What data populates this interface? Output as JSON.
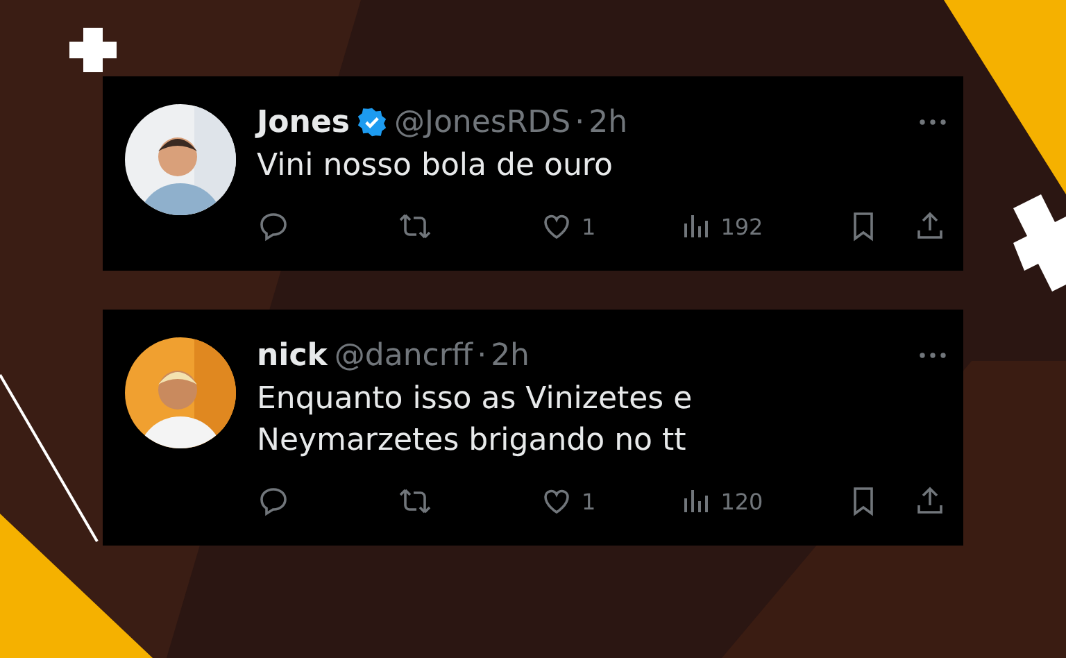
{
  "tweets": [
    {
      "name": "Jones",
      "verified": true,
      "handle": "@JonesRDS",
      "sep": "·",
      "time": "2h",
      "text": [
        "Vini nosso bola de ouro"
      ],
      "avatar": {
        "kind": "picture"
      },
      "likes": "1",
      "views": "192"
    },
    {
      "name": "nick",
      "verified": false,
      "handle": "@dancrff",
      "sep": "·",
      "time": "2h",
      "text": [
        "Enquanto isso as Vinizetes e",
        "Neymarzetes brigando no tt"
      ],
      "avatar": {
        "kind": "picture"
      },
      "likes": "1",
      "views": "120"
    }
  ]
}
